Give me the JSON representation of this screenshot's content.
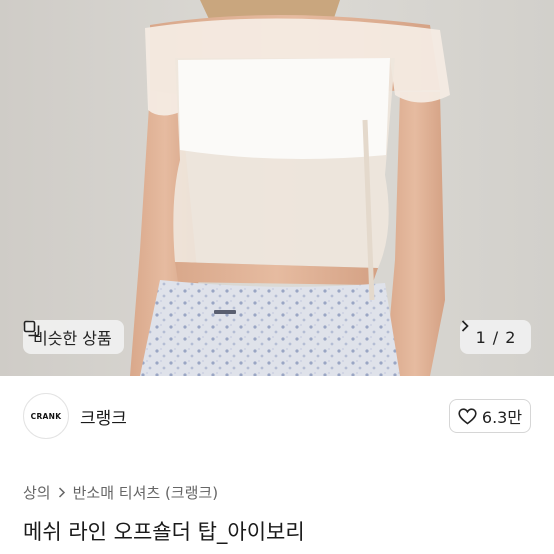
{
  "hero": {
    "similar_label": "비슷한 상품",
    "pager": {
      "current": "1",
      "separator": "/",
      "total": "2"
    }
  },
  "shop": {
    "logo_text": "CRANK",
    "name": "크랭크",
    "likes": "6.3만"
  },
  "breadcrumb": {
    "category": "상의",
    "subcategory": "반소매 티셔츠 (크랭크)"
  },
  "product": {
    "title": "메쉬 라인 오프숄더 탑_아이보리"
  },
  "colors": {
    "background": "#ffffff",
    "text_primary": "#1a1a1a",
    "text_secondary": "#666666",
    "border": "#d6d6d6"
  },
  "icons": {
    "similar": "copy-icon",
    "pager": "chevron-right-icon",
    "like": "heart-outline-icon",
    "breadcrumb": "chevron-right-icon"
  }
}
